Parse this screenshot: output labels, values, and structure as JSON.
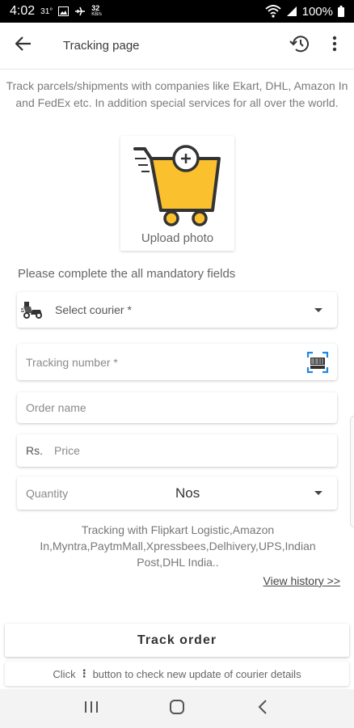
{
  "status_bar": {
    "time": "4:02",
    "temp": "31°",
    "data_speed": "32",
    "data_speed_unit": "KB/s",
    "battery": "100%"
  },
  "app_bar": {
    "title": "Tracking page",
    "back_icon": "arrow-back-icon",
    "history_icon": "history-icon",
    "more_icon": "more-vert-icon"
  },
  "intro": "Track parcels/shipments with companies like Ekart, DHL, Amazon In and FedEx etc. In addition special services for all over the world.",
  "upload": {
    "label": "Upload photo",
    "icon": "cart-add-icon",
    "cart_color": "#fbc02d"
  },
  "form": {
    "mandatory_note": "Please complete the all mandatory fields",
    "courier_placeholder": "Select courier *",
    "tracking_placeholder": "Tracking number *",
    "order_placeholder": "Order name",
    "currency_label": "Rs.",
    "price_placeholder": "Price",
    "quantity_label": "Quantity",
    "quantity_unit": "Nos"
  },
  "couriers_text": "Tracking with Flipkart Logistic,Amazon In,Myntra,PaytmMall,Xpressbees,Delhivery,UPS,Indian Post,DHL India..",
  "view_history": "View history >>",
  "track_button": "Track order",
  "hint": {
    "before": "Click",
    "after": "button to check new update of courier details"
  }
}
